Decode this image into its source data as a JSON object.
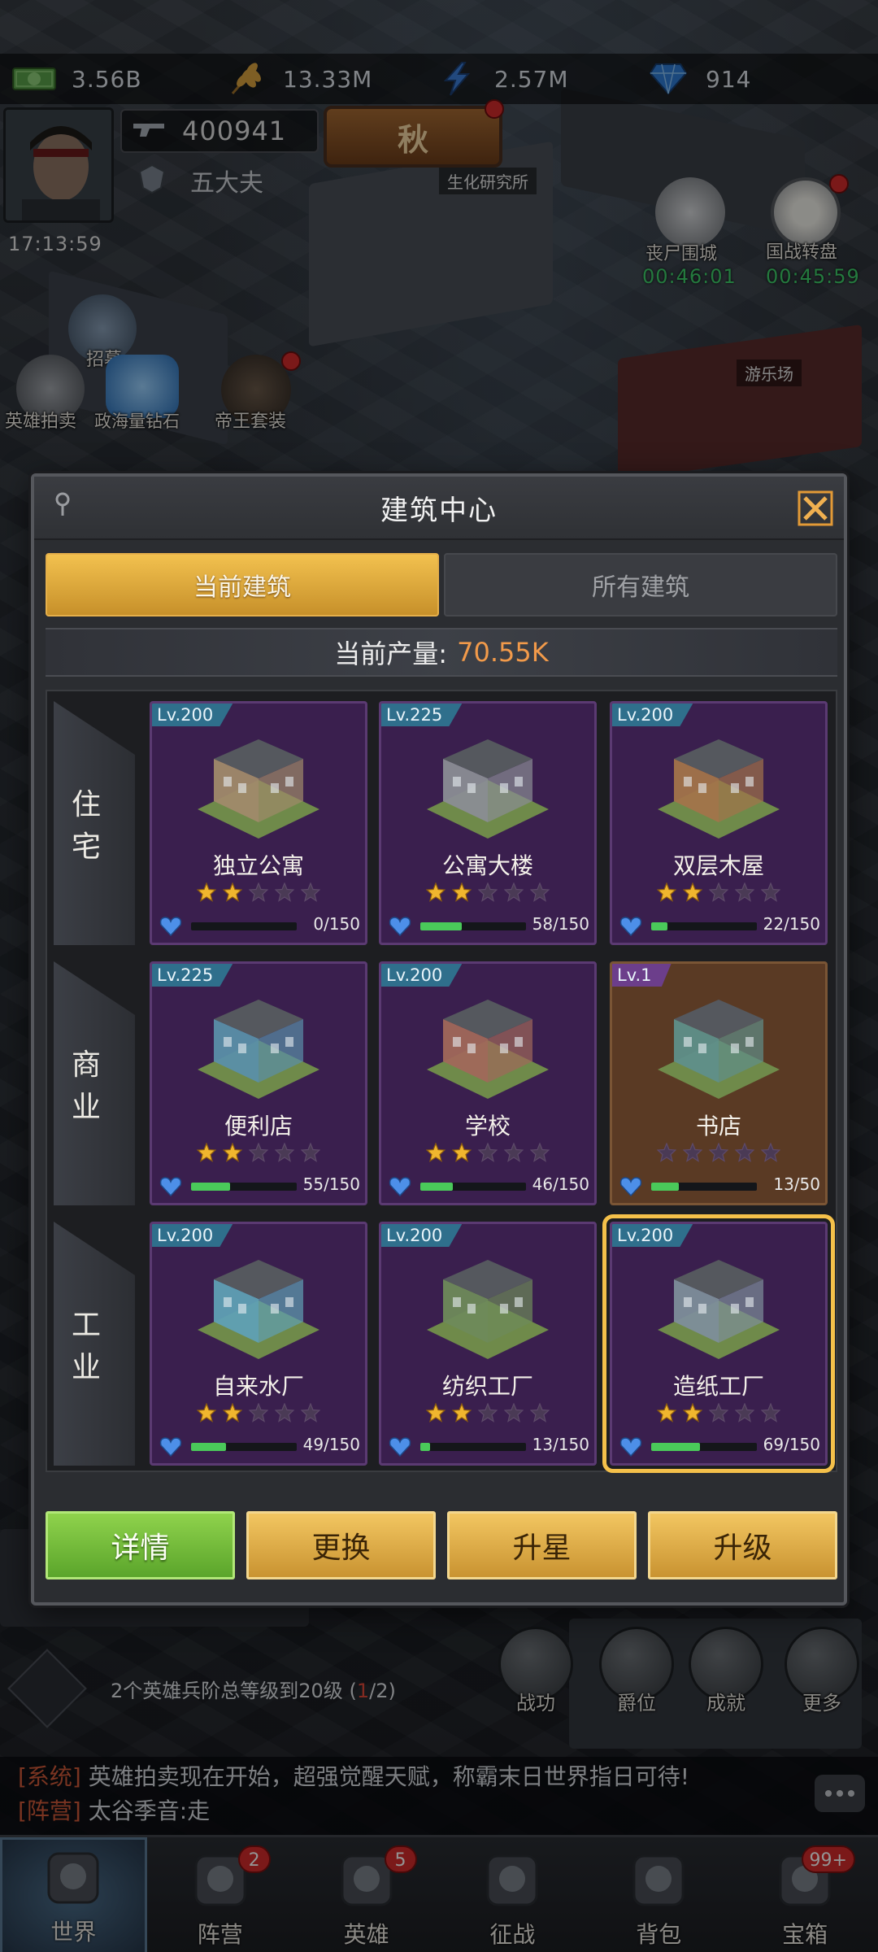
{
  "resources": [
    {
      "icon": "cash-icon",
      "value": "3.56B"
    },
    {
      "icon": "wheat-icon",
      "value": "13.33M"
    },
    {
      "icon": "lightning-icon",
      "value": "2.57M"
    },
    {
      "icon": "diamond-icon",
      "value": "914"
    }
  ],
  "player": {
    "power": "400941",
    "rank": "五大夫",
    "time": "17:13:59"
  },
  "season": {
    "label": "秋"
  },
  "map_labels": {
    "lab": "生化研究所",
    "amusement": "游乐场"
  },
  "events": {
    "zombie_siege": {
      "label": "丧尸围城",
      "timer": "00:46:01"
    },
    "war_wheel": {
      "label": "国战转盘",
      "timer": "00:45:59"
    },
    "hero_auction": {
      "label": "英雄拍卖"
    },
    "diamonds": {
      "label": "政海量钻石"
    },
    "emperor_pack": {
      "label": "帝王套装"
    },
    "recruit": {
      "label": "招募"
    }
  },
  "panel": {
    "title": "建筑中心",
    "tabs": [
      {
        "label": "当前建筑",
        "active": true
      },
      {
        "label": "所有建筑",
        "active": false
      }
    ],
    "production_label": "当前产量:",
    "production_value": "70.55K",
    "categories": [
      {
        "name": "住宅",
        "buildings": [
          {
            "level": "Lv.200",
            "name": "独立公寓",
            "stars": 2,
            "progress": "0/150",
            "fill": 0.0,
            "style": "purple",
            "accent": "#a08a6a"
          },
          {
            "level": "Lv.225",
            "name": "公寓大楼",
            "stars": 2,
            "progress": "58/150",
            "fill": 0.387,
            "style": "purple",
            "accent": "#8a8d94"
          },
          {
            "level": "Lv.200",
            "name": "双层木屋",
            "stars": 2,
            "progress": "22/150",
            "fill": 0.147,
            "style": "purple",
            "accent": "#a2744a"
          }
        ]
      },
      {
        "name": "商业",
        "buildings": [
          {
            "level": "Lv.225",
            "name": "便利店",
            "stars": 2,
            "progress": "55/150",
            "fill": 0.367,
            "style": "purple",
            "accent": "#5a8fa8"
          },
          {
            "level": "Lv.200",
            "name": "学校",
            "stars": 2,
            "progress": "46/150",
            "fill": 0.307,
            "style": "purple",
            "accent": "#a0685a"
          },
          {
            "level": "Lv.1",
            "name": "书店",
            "stars": 0,
            "progress": "13/50",
            "fill": 0.26,
            "style": "brown",
            "accent": "#5f8f8a"
          }
        ]
      },
      {
        "name": "工业",
        "buildings": [
          {
            "level": "Lv.200",
            "name": "自来水厂",
            "stars": 2,
            "progress": "49/150",
            "fill": 0.327,
            "style": "purple",
            "accent": "#5fa0b4"
          },
          {
            "level": "Lv.200",
            "name": "纺织工厂",
            "stars": 2,
            "progress": "13/150",
            "fill": 0.087,
            "style": "purple",
            "accent": "#6e8a5a"
          },
          {
            "level": "Lv.200",
            "name": "造纸工厂",
            "stars": 2,
            "progress": "69/150",
            "fill": 0.46,
            "style": "purple",
            "accent": "#7d8e9a",
            "selected": true
          }
        ]
      }
    ],
    "actions": [
      {
        "label": "详情",
        "style": "green"
      },
      {
        "label": "更换",
        "style": "gold"
      },
      {
        "label": "升星",
        "style": "gold"
      },
      {
        "label": "升级",
        "style": "gold"
      }
    ]
  },
  "quest": {
    "text": "2个英雄兵阶总等级到20级",
    "progress_open": "(",
    "progress_current": "1",
    "progress_rest": "/2)"
  },
  "hud_buttons": [
    {
      "label": "战功",
      "icon": "medal-icon"
    },
    {
      "label": "爵位",
      "icon": "rank-icon"
    },
    {
      "label": "成就",
      "icon": "achievement-icon"
    },
    {
      "label": "更多",
      "icon": "more-icon"
    }
  ],
  "chat": [
    {
      "tag": "[系统]",
      "message": "英雄拍卖现在开始，超强觉醒天赋，称霸末日世界指日可待!"
    },
    {
      "tag": "[阵营]",
      "message": "太谷季音:走"
    }
  ],
  "nav": [
    {
      "label": "世界",
      "icon": "world-map-icon",
      "badge": "",
      "active": true
    },
    {
      "label": "阵营",
      "icon": "faction-icon",
      "badge": "2",
      "active": false
    },
    {
      "label": "英雄",
      "icon": "hero-icon",
      "badge": "5",
      "active": false
    },
    {
      "label": "征战",
      "icon": "battle-icon",
      "badge": "",
      "active": false
    },
    {
      "label": "背包",
      "icon": "backpack-icon",
      "badge": "",
      "active": false
    },
    {
      "label": "宝箱",
      "icon": "chest-icon",
      "badge": "99+",
      "active": false
    }
  ],
  "colors": {
    "accent_gold": "#f2c14f",
    "production_value": "#f29a4a",
    "progress_green": "#4ac95a",
    "card_purple": "#3a1f4e",
    "card_brown": "#5a3a24",
    "star_gold": "#f0b62e",
    "timer_green": "#3fd06b",
    "alert_red": "#d42b2b"
  }
}
